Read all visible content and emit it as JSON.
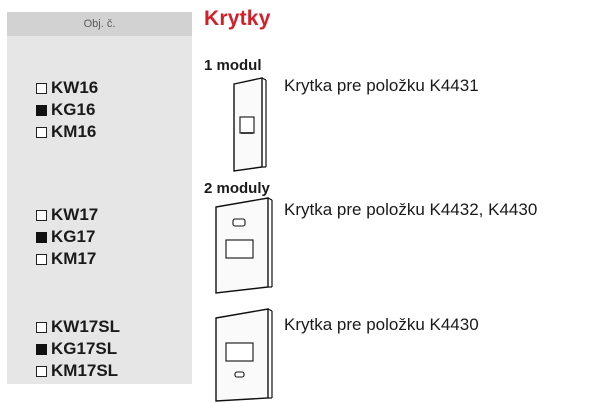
{
  "header": {
    "column_label": "Obj. č.",
    "title": "Krytky"
  },
  "groups": [
    {
      "section_label": "1 modul",
      "description": "Krytka pre položku K4431",
      "icon": "single-module-cover-icon",
      "codes": [
        {
          "label": "KW16",
          "marker": "empty"
        },
        {
          "label": "KG16",
          "marker": "filled"
        },
        {
          "label": "KM16",
          "marker": "empty"
        }
      ]
    },
    {
      "section_label": "2 moduly",
      "description": "Krytka pre položku K4432, K4430",
      "icon": "double-module-cover-icon",
      "codes": [
        {
          "label": "KW17",
          "marker": "empty"
        },
        {
          "label": "KG17",
          "marker": "filled"
        },
        {
          "label": "KM17",
          "marker": "empty"
        }
      ]
    },
    {
      "section_label": "",
      "description": "Krytka pre položku K4430",
      "icon": "double-module-cover-sl-icon",
      "codes": [
        {
          "label": "KW17SL",
          "marker": "empty"
        },
        {
          "label": "KG17SL",
          "marker": "filled"
        },
        {
          "label": "KM17SL",
          "marker": "empty"
        }
      ]
    }
  ]
}
